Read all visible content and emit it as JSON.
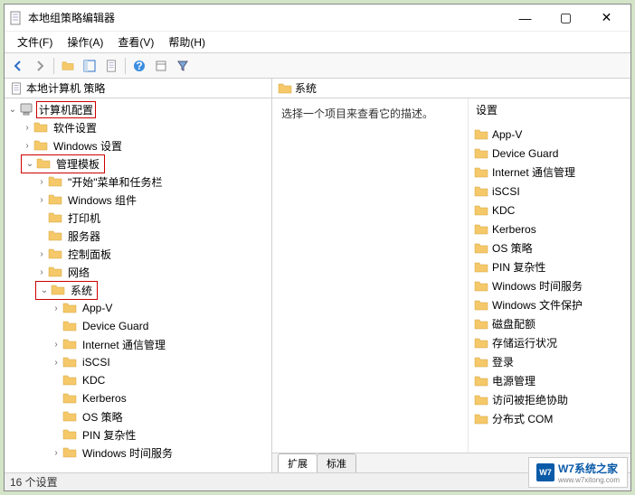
{
  "window": {
    "title": "本地组策略编辑器"
  },
  "menu": {
    "file": "文件(F)",
    "action": "操作(A)",
    "view": "查看(V)",
    "help": "帮助(H)"
  },
  "left": {
    "header": "本地计算机 策略",
    "nodes": {
      "computer_config": "计算机配置",
      "software_settings": "软件设置",
      "windows_settings": "Windows 设置",
      "admin_templates": "管理模板",
      "start_menu": "\"开始\"菜单和任务栏",
      "windows_components": "Windows 组件",
      "printers": "打印机",
      "servers": "服务器",
      "control_panel": "控制面板",
      "network": "网络",
      "system": "系统",
      "appv": "App-V",
      "device_guard": "Device Guard",
      "internet_comm": "Internet 通信管理",
      "iscsi": "iSCSI",
      "kdc": "KDC",
      "kerberos": "Kerberos",
      "os_policy": "OS 策略",
      "pin_complexity": "PIN 复杂性",
      "windows_time": "Windows 时间服务"
    }
  },
  "right": {
    "header": "系统",
    "description": "选择一个项目来查看它的描述。",
    "column_header": "设置",
    "items": [
      "App-V",
      "Device Guard",
      "Internet 通信管理",
      "iSCSI",
      "KDC",
      "Kerberos",
      "OS 策略",
      "PIN 复杂性",
      "Windows 时间服务",
      "Windows 文件保护",
      "磁盘配额",
      "存储运行状况",
      "登录",
      "电源管理",
      "访问被拒绝协助",
      "分布式 COM"
    ],
    "tabs": {
      "extended": "扩展",
      "standard": "标准"
    }
  },
  "status": "16 个设置",
  "watermark": "W7系统之家",
  "watermark_url": "www.w7xitong.com"
}
